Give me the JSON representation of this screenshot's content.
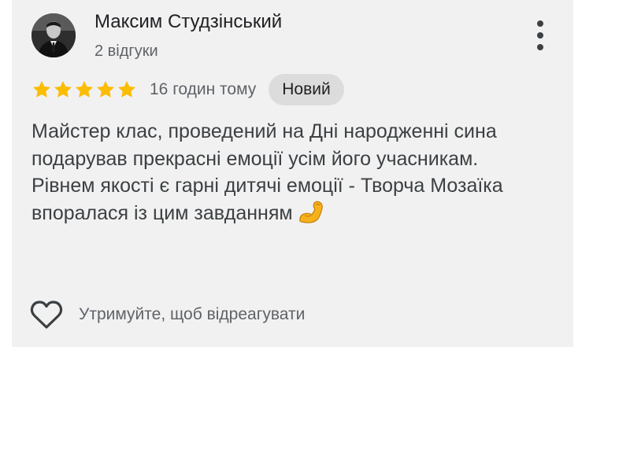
{
  "review": {
    "author": {
      "name": "Максим Студзінський",
      "review_count": "2 відгуки",
      "avatar_icon": "user-photo-avatar"
    },
    "rating": 5,
    "rating_max": 5,
    "time_ago": "16 годин тому",
    "badge": "Новий",
    "text_lines": [
      "Майстер клас, проведений на Дні народженні сина подарував прекрасні емоції усім його учасникам.",
      "Рівнем якості є гарні дитячі емоції - Творча Мозаїка впоралася із цим завданням"
    ],
    "emoji": "flexed-biceps-emoji"
  },
  "actions": {
    "react_label": "Утримуйте, щоб відреагувати",
    "react_icon": "heart-outline-icon",
    "more_icon": "more-vertical-icon"
  },
  "colors": {
    "card_background": "#f1f1f1",
    "star": "#fbbc04",
    "badge_background": "#dcdcdc",
    "secondary_text": "#5f6368",
    "primary_text": "#202124"
  }
}
